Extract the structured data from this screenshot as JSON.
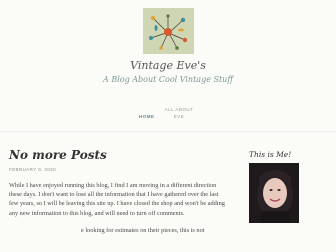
{
  "site": {
    "title": "Vintage Eve's",
    "tagline": "A Blog About Cool Vintage Stuff"
  },
  "nav": {
    "home": "HOME",
    "about": "ALL ABOUT EVE"
  },
  "post": {
    "title": "No more Posts",
    "date": "FEBRUARY 9, 2020",
    "paragraphs": [
      "While I have enjoyed running this blog, I find I am moving in a different direction these days. I don't want to lose all the information that I have gathered over the last few years, so I will be leaving this site up. I have closed the shop and won't be adding any new information to this blog, and will need to turn off comments.",
      "e looking for estimates on their pieces, this is not"
    ]
  },
  "sidebar": {
    "widget_title": "This is Me!"
  },
  "colors": {
    "accent": "#5f8f94",
    "tagline": "#7a9a96",
    "background": "#fbfbf7"
  }
}
